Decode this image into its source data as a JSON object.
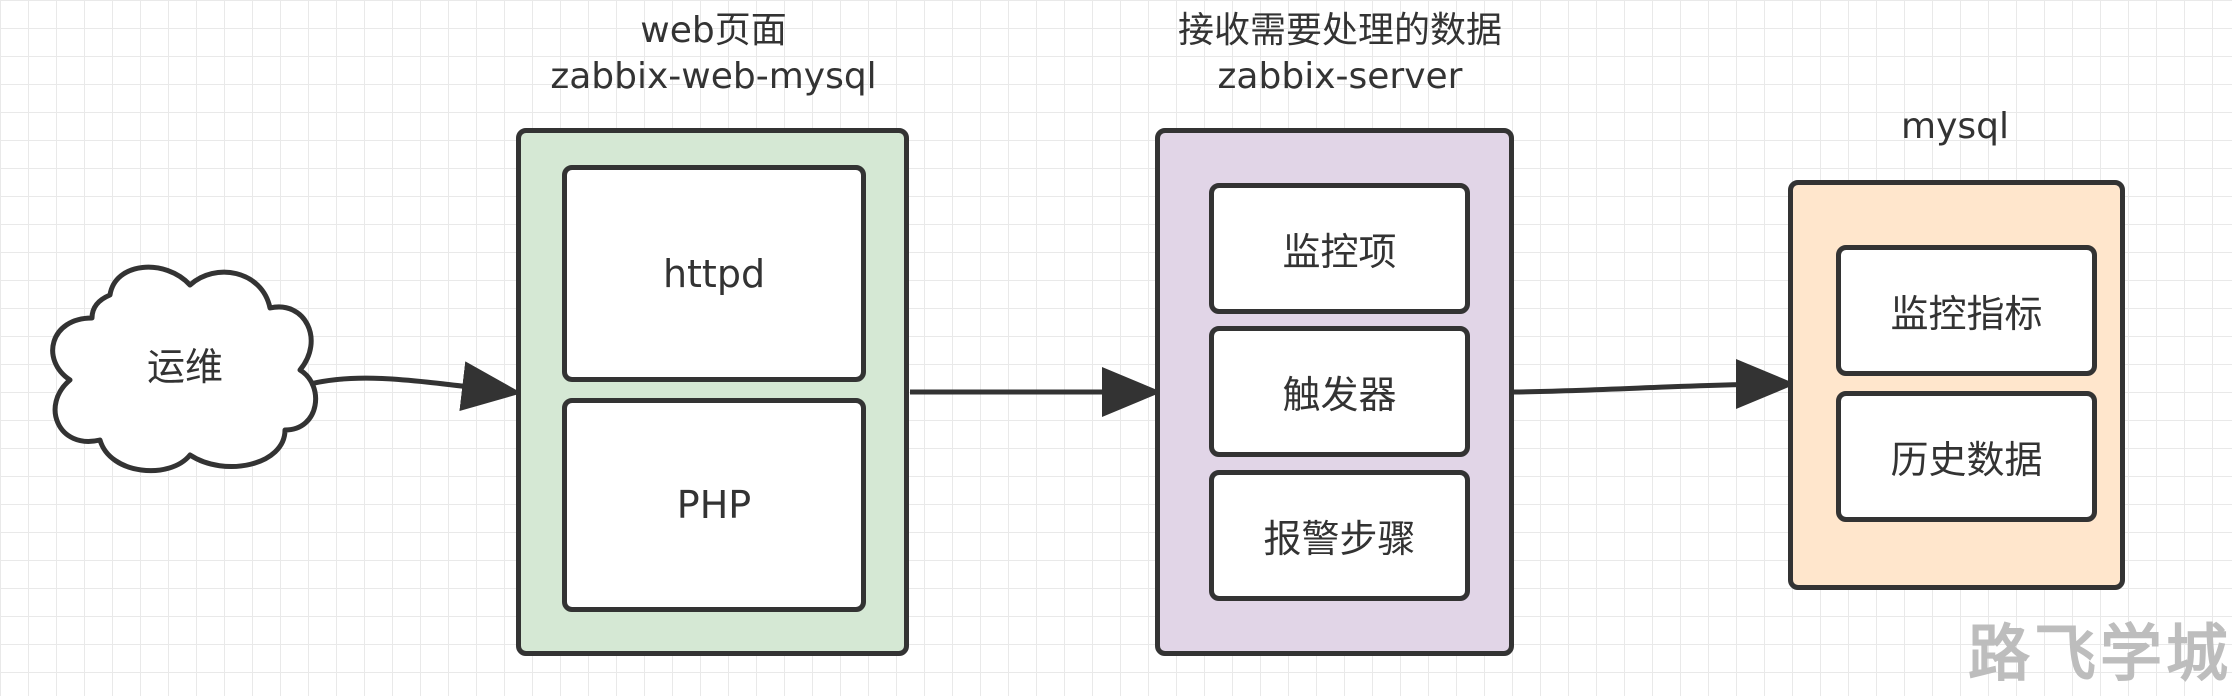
{
  "cloud": {
    "label": "运维"
  },
  "web": {
    "title": "web页面",
    "subtitle": "zabbix-web-mysql",
    "items": [
      "httpd",
      "PHP"
    ],
    "fill": "#d5e8d4"
  },
  "server": {
    "title": "接收需要处理的数据",
    "subtitle": "zabbix-server",
    "items": [
      "监控项",
      "触发器",
      "报警步骤"
    ],
    "fill": "#e1d5e7"
  },
  "db": {
    "title": "mysql",
    "items": [
      "监控指标",
      "历史数据"
    ],
    "fill": "#ffe6cc"
  },
  "watermark": "路飞学城"
}
